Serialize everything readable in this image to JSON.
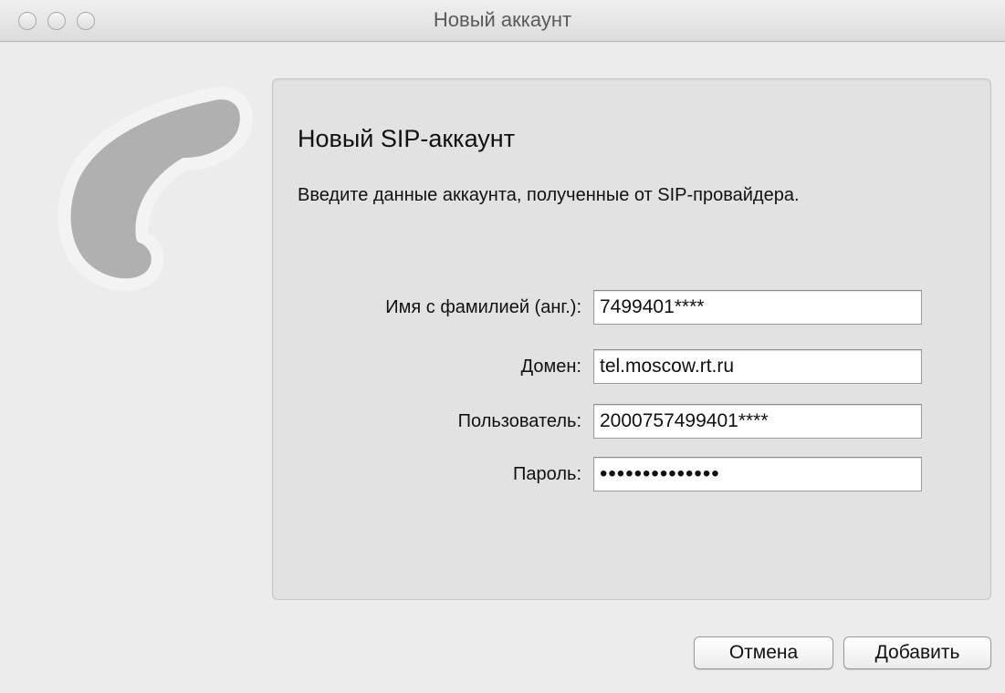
{
  "window": {
    "title": "Новый аккаунт"
  },
  "panel": {
    "heading": "Новый SIP-аккаунт",
    "description": "Введите данные аккаунта, полученные от SIP-провайдера."
  },
  "form": {
    "fields": [
      {
        "label": "Имя с фамилией (анг.):",
        "value": "7499401****"
      },
      {
        "label": "Домен:",
        "value": "tel.moscow.rt.ru"
      },
      {
        "label": "Пользователь:",
        "value": "2000757499401****"
      },
      {
        "label": "Пароль:",
        "value": "••••••••••••••"
      }
    ]
  },
  "buttons": {
    "cancel_label": "Отмена",
    "add_label": "Добавить"
  },
  "icons": {
    "logo": "phone-handset-icon"
  },
  "colors": {
    "window_bg": "#ececec",
    "panel_bg": "#e2e2e2",
    "logo_fill": "#b0b0b0",
    "logo_outline": "#f3f3f3"
  }
}
